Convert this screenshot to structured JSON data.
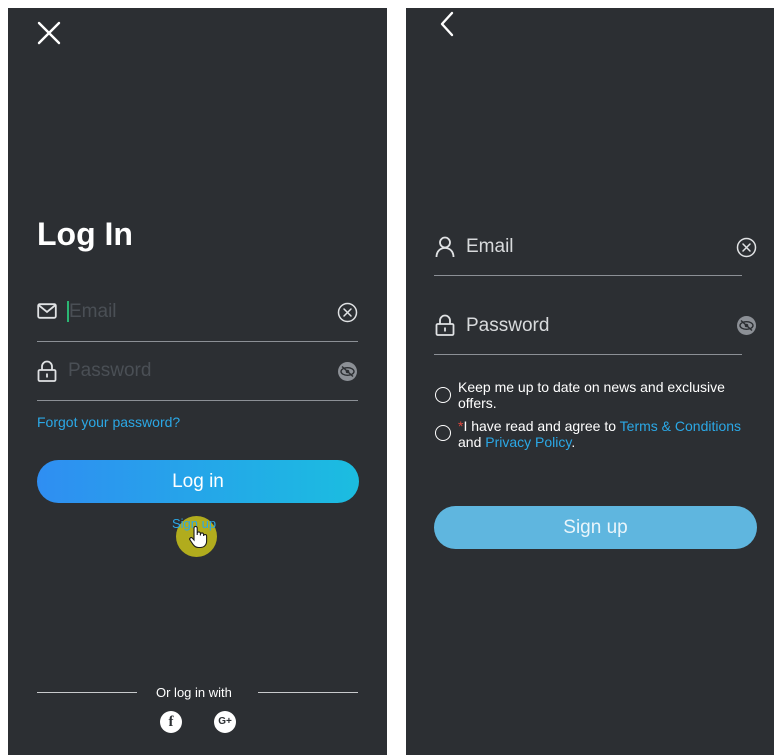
{
  "login": {
    "title": "Log In",
    "email_placeholder": "Email",
    "password_placeholder": "Password",
    "forgot_label": "Forgot your password?",
    "login_button": "Log in",
    "signup_link": "Sign up",
    "or_login_with": "Or log in with",
    "social": [
      "f",
      "G+"
    ],
    "icons": {
      "close": "close-icon",
      "mail": "mail-icon",
      "lock": "lock-icon",
      "clear": "clear-icon",
      "eye": "eye-hidden-icon",
      "facebook": "facebook-icon",
      "google": "google-plus-icon"
    }
  },
  "signup": {
    "email_label": "Email",
    "password_label": "Password",
    "newsletter_text": "Keep me up to date on news and exclusive offers.",
    "terms_required_mark": "*",
    "terms_prefix": "I have read and agree to ",
    "terms_link": "Terms & Conditions",
    "terms_and": " and ",
    "privacy_link": "Privacy Policy",
    "terms_suffix": ".",
    "signup_button": "Sign up",
    "icons": {
      "back": "back-icon",
      "user": "user-icon",
      "lock": "lock-icon",
      "clear": "clear-icon",
      "eye": "eye-hidden-icon"
    }
  },
  "colors": {
    "panel_bg": "#2c2f33",
    "accent": "#2ba8e6",
    "button_gradient_start": "#2f8ef2",
    "button_gradient_end": "#1bbde0",
    "signup_button": "#5fb6df",
    "required_mark": "#e0463c"
  }
}
